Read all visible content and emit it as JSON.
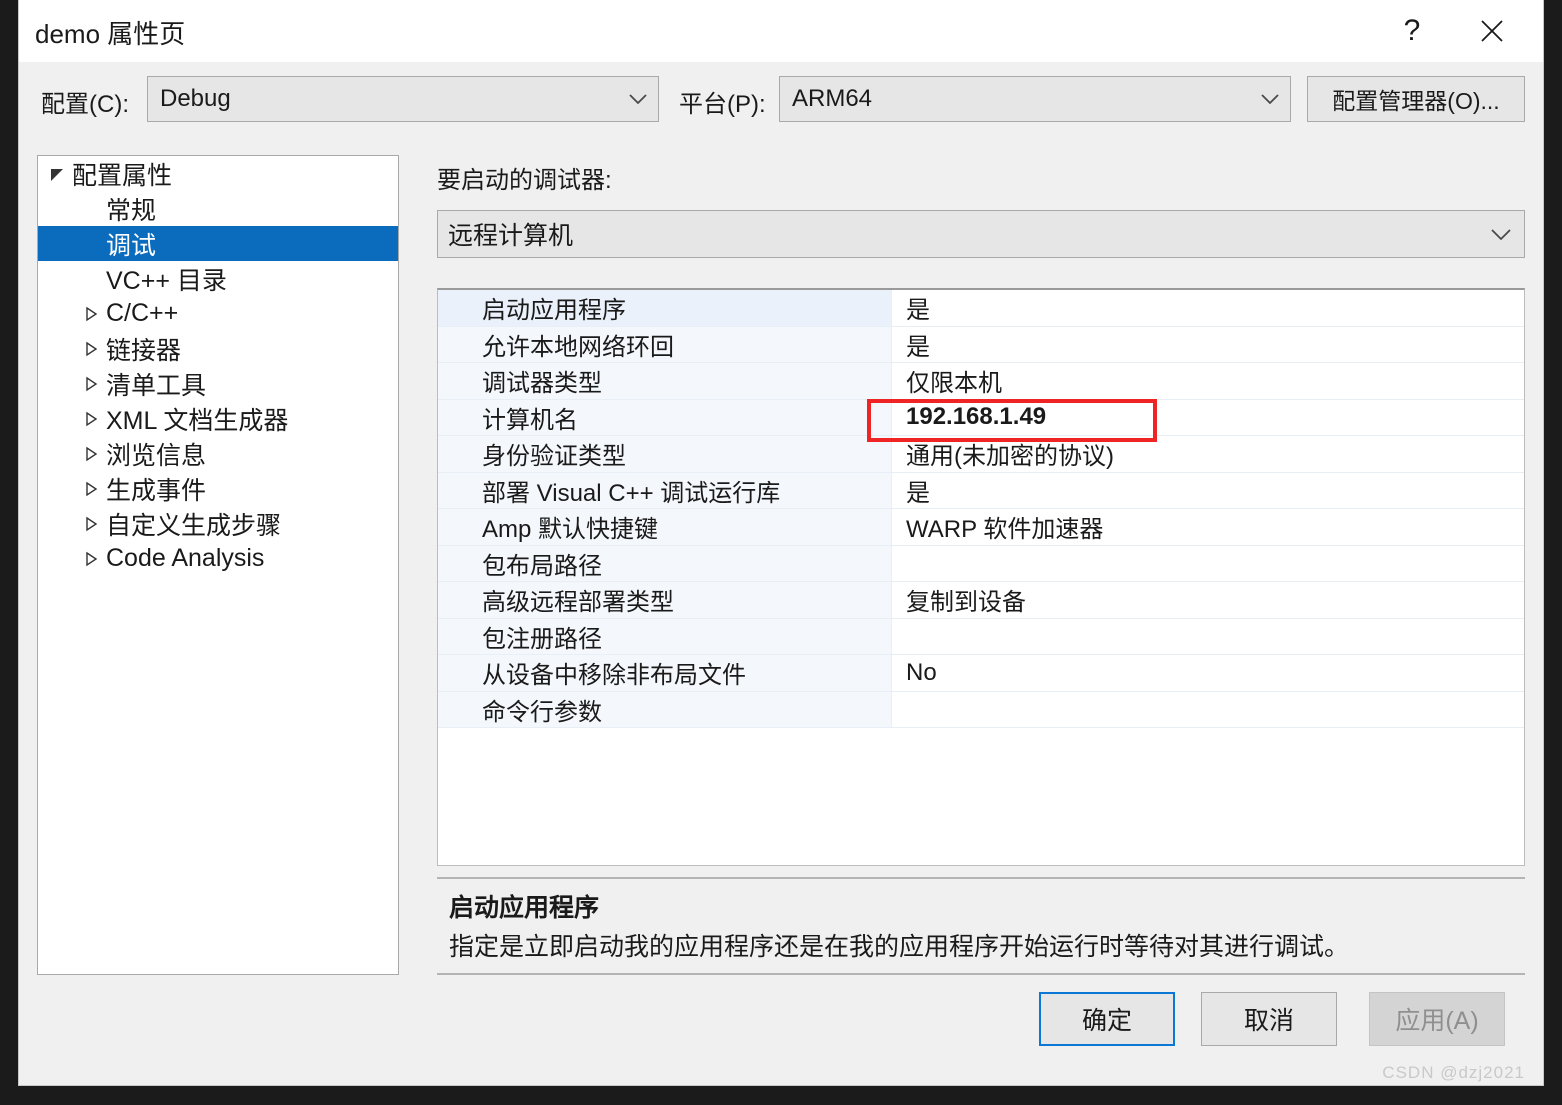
{
  "window": {
    "title": "demo 属性页",
    "help_icon": "help-icon",
    "help_glyph": "?",
    "close_icon": "close-icon"
  },
  "config_bar": {
    "config_label": "配置(C):",
    "config_value": "Debug",
    "platform_label": "平台(P):",
    "platform_value": "ARM64",
    "config_manager_button": "配置管理器(O)..."
  },
  "tree": {
    "items": [
      {
        "label": "配置属性",
        "level": 0,
        "expander": "expanded",
        "selected": false
      },
      {
        "label": "常规",
        "level": 1,
        "expander": "none",
        "selected": false
      },
      {
        "label": "调试",
        "level": 1,
        "expander": "none",
        "selected": true
      },
      {
        "label": "VC++ 目录",
        "level": 1,
        "expander": "none",
        "selected": false
      },
      {
        "label": "C/C++",
        "level": 1,
        "expander": "collapsed",
        "selected": false
      },
      {
        "label": "链接器",
        "level": 1,
        "expander": "collapsed",
        "selected": false
      },
      {
        "label": "清单工具",
        "level": 1,
        "expander": "collapsed",
        "selected": false
      },
      {
        "label": "XML 文档生成器",
        "level": 1,
        "expander": "collapsed",
        "selected": false
      },
      {
        "label": "浏览信息",
        "level": 1,
        "expander": "collapsed",
        "selected": false
      },
      {
        "label": "生成事件",
        "level": 1,
        "expander": "collapsed",
        "selected": false
      },
      {
        "label": "自定义生成步骤",
        "level": 1,
        "expander": "collapsed",
        "selected": false
      },
      {
        "label": "Code Analysis",
        "level": 1,
        "expander": "collapsed",
        "selected": false
      }
    ]
  },
  "main": {
    "debugger_caption": "要启动的调试器:",
    "debugger_value": "远程计算机",
    "properties": [
      {
        "name": "启动应用程序",
        "value": "是",
        "selected": true,
        "highlighted": false
      },
      {
        "name": "允许本地网络环回",
        "value": "是",
        "selected": false,
        "highlighted": false
      },
      {
        "name": "调试器类型",
        "value": "仅限本机",
        "selected": false,
        "highlighted": false
      },
      {
        "name": "计算机名",
        "value": "192.168.1.49",
        "selected": false,
        "highlighted": true
      },
      {
        "name": "身份验证类型",
        "value": "通用(未加密的协议)",
        "selected": false,
        "highlighted": false
      },
      {
        "name": "部署 Visual C++ 调试运行库",
        "value": "是",
        "selected": false,
        "highlighted": false
      },
      {
        "name": "Amp 默认快捷键",
        "value": "WARP 软件加速器",
        "selected": false,
        "highlighted": false
      },
      {
        "name": "包布局路径",
        "value": "",
        "selected": false,
        "highlighted": false
      },
      {
        "name": "高级远程部署类型",
        "value": "复制到设备",
        "selected": false,
        "highlighted": false
      },
      {
        "name": "包注册路径",
        "value": "",
        "selected": false,
        "highlighted": false
      },
      {
        "name": "从设备中移除非布局文件",
        "value": "No",
        "selected": false,
        "highlighted": false
      },
      {
        "name": "命令行参数",
        "value": "",
        "selected": false,
        "highlighted": false
      }
    ],
    "description": {
      "title": "启动应用程序",
      "body": "指定是立即启动我的应用程序还是在我的应用程序开始运行时等待对其进行调试。"
    }
  },
  "footer": {
    "ok_label": "确定",
    "cancel_label": "取消",
    "apply_label": "应用(A)"
  },
  "watermark": "CSDN @dzj2021",
  "colors": {
    "accent_blue": "#0b6cbe",
    "focus_blue": "#0b78d7",
    "highlight_red": "#ef2424",
    "dialog_bg": "#f0f0f0",
    "control_bg": "#e6e6e6",
    "grid_name_bg": "#f4f7fb"
  }
}
